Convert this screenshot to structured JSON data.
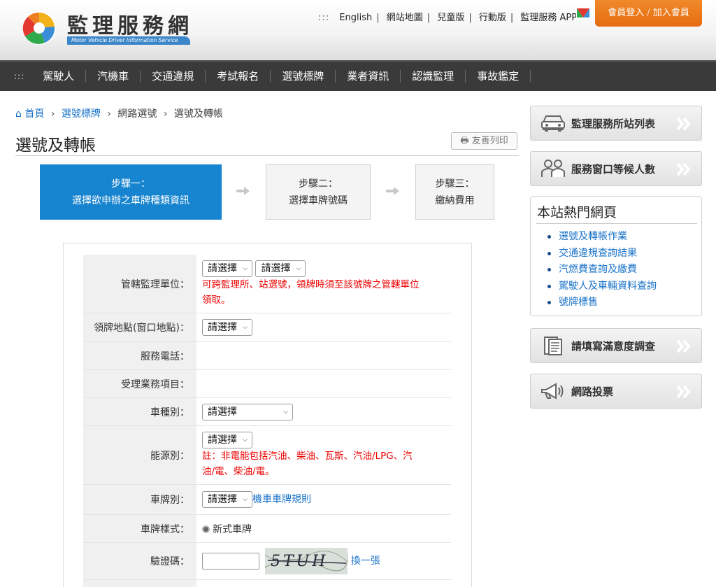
{
  "header": {
    "logo_title": "監理服務網",
    "logo_subtitle": "Motor Vehicle Driver Information Service",
    "dots": ":::",
    "top_links": [
      "English",
      "網站地圖",
      "兒童版",
      "行動版",
      "監理服務 APP"
    ],
    "login_label": "會員登入",
    "register_label": "加入會員"
  },
  "nav": {
    "dots": ":::",
    "items": [
      "駕駛人",
      "汽機車",
      "交通違規",
      "考試報名",
      "選號標牌",
      "業者資訊",
      "認識監理",
      "事故鑑定"
    ]
  },
  "breadcrumb": {
    "home": "首頁",
    "level1": "選號標牌",
    "level2": "網路選號",
    "current": "選號及轉帳",
    "separator": "›"
  },
  "page_title": "選號及轉帳",
  "print_label": "友善列印",
  "steps": [
    {
      "line1": "步驟一：",
      "line2": "選擇欲申辦之車牌種類資訊"
    },
    {
      "line1": "步驟二：",
      "line2": "選擇車牌號碼"
    },
    {
      "line1": "步驟三：",
      "line2": "繳納費用"
    }
  ],
  "form": {
    "office": {
      "label": "管轄監理單位：",
      "select1": "請選擇",
      "select2": "請選擇",
      "note_line1": "可跨監理所、站選號，領牌時須至該號牌之管轄單位",
      "note_line2": "領取。"
    },
    "pickup": {
      "label": "領牌地點(窗口地點)：",
      "select": "請選擇"
    },
    "phone": {
      "label": "服務電話：",
      "value": ""
    },
    "business": {
      "label": "受理業務項目：",
      "value": ""
    },
    "vehicle_type": {
      "label": "車種別：",
      "select": "請選擇"
    },
    "energy": {
      "label": "能源別：",
      "select": "請選擇",
      "note_line1": "註：非電能包括汽油、柴油、瓦斯、汽油/LPG、汽",
      "note_line2": "油/電、柴油/電。"
    },
    "plate_type": {
      "label": "車牌別：",
      "select": "請選擇",
      "link": "機車車牌規則"
    },
    "plate_style": {
      "label": "車牌樣式：",
      "option": "新式車牌"
    },
    "captcha": {
      "label": "驗證碼：",
      "input_value": "",
      "image_text": "5TUH",
      "refresh": "換一張"
    }
  },
  "sidebar": {
    "buttons": [
      {
        "label": "監理服務所站列表",
        "icon": "car-icon"
      },
      {
        "label": "服務窗口等候人數",
        "icon": "people-icon"
      },
      {
        "label": "請填寫滿意度調查",
        "icon": "survey-icon"
      },
      {
        "label": "網路投票",
        "icon": "megaphone-icon"
      }
    ],
    "hot_title": "本站熱門網頁",
    "hot_links": [
      "選號及轉帳作業",
      "交通違規查詢結果",
      "汽燃費查詢及繳費",
      "駕駛人及車輛資料查詢",
      "號牌標售"
    ]
  },
  "colors": {
    "accent": "#1784cf",
    "nav_bg": "#3a3a3a",
    "login": "#e87a1e",
    "warning": "#e00000",
    "link": "#1a73c9"
  }
}
